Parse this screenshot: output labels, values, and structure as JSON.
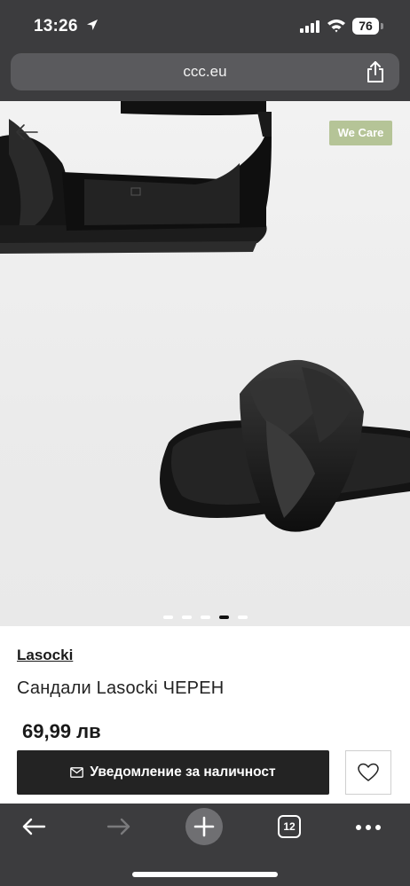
{
  "status_bar": {
    "time": "13:26",
    "battery": "76"
  },
  "browser": {
    "url": "ccc.eu",
    "tab_count": "12"
  },
  "gallery": {
    "badge": "We Care",
    "slide_count": 5,
    "active_slide": 4
  },
  "product": {
    "brand": "Lasocki",
    "name": "Сандали Lasocki ЧЕРЕН",
    "price": "69,99 лв",
    "notify_label": "Уведомление за наличност"
  },
  "icons": {
    "location": "location-arrow-icon",
    "signal": "cell-signal-icon",
    "wifi": "wifi-icon",
    "battery": "battery-icon",
    "share": "share-icon",
    "back": "back-arrow-icon",
    "mail": "envelope-icon",
    "favorite": "heart-icon",
    "new_tab": "plus-icon",
    "more": "more-dots-icon"
  },
  "colors": {
    "chrome": "#3c3c3e",
    "badge": "#b5c497",
    "button": "#232323"
  }
}
